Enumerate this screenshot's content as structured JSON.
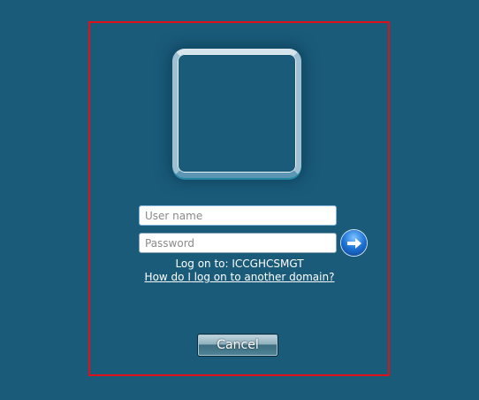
{
  "login": {
    "username_placeholder": "User name",
    "password_placeholder": "Password",
    "submit_icon": "arrow-right-icon",
    "logon_to": "Log on to: ICCGHCSMGT",
    "domain_help_link": "How do I log on to another domain?",
    "cancel_label": "Cancel"
  },
  "colors": {
    "background": "#1a5b7a",
    "highlight_border": "#e0101a"
  }
}
